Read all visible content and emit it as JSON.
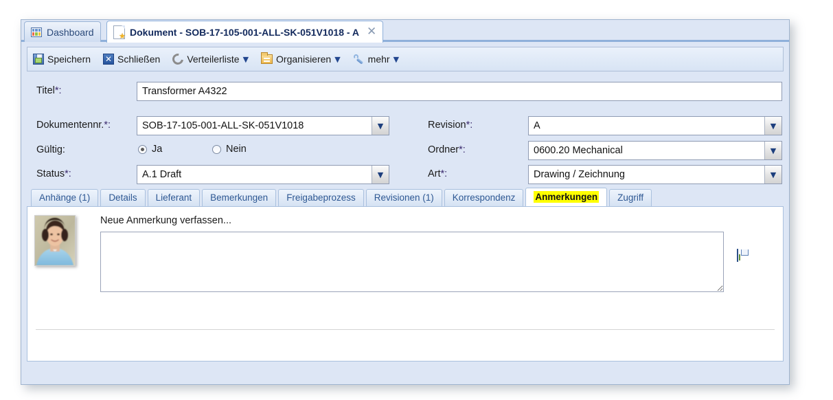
{
  "window_tabs": [
    {
      "label": "Dashboard",
      "icon": "dashboard-grid-icon",
      "active": false,
      "closable": false
    },
    {
      "label": "Dokument - SOB-17-105-001-ALL-SK-051V1018 - A",
      "icon": "document-star-icon",
      "active": true,
      "closable": true,
      "close_glyph": "✕"
    }
  ],
  "toolbar": {
    "items": [
      {
        "label": "Speichern",
        "icon": "save-floppy-icon",
        "caret": false
      },
      {
        "label": "Schließen",
        "icon": "close-x-icon",
        "caret": false
      },
      {
        "label": "Verteilerliste",
        "icon": "distribution-recycle-icon",
        "caret": true
      },
      {
        "label": "Organisieren",
        "icon": "folder-icon",
        "caret": true
      },
      {
        "label": "mehr",
        "icon": "wrench-icon",
        "caret": true
      }
    ],
    "caret_glyph": "▼"
  },
  "form": {
    "title": {
      "label": "Titel",
      "required_mark": "*:",
      "value": "Transformer A4322"
    },
    "document_number": {
      "label": "Dokumentennr.",
      "required_mark": "*:",
      "value": "SOB-17-105-001-ALL-SK-051V1018"
    },
    "valid": {
      "label": "Gültig:",
      "options": [
        {
          "label": "Ja",
          "selected": true
        },
        {
          "label": "Nein",
          "selected": false
        }
      ]
    },
    "status": {
      "label": "Status",
      "required_mark": "*:",
      "value": "A.1 Draft"
    },
    "revision": {
      "label": "Revision",
      "required_mark": "*:",
      "value": "A"
    },
    "folder": {
      "label": "Ordner",
      "required_mark": "*:",
      "value": "0600.20 Mechanical"
    },
    "art": {
      "label": "Art",
      "required_mark": "*:",
      "value": "Drawing / Zeichnung"
    },
    "dropdown_glyph": "▼"
  },
  "content_tabs": [
    {
      "label": "Anhänge (1)",
      "active": false
    },
    {
      "label": "Details",
      "active": false
    },
    {
      "label": "Lieferant",
      "active": false
    },
    {
      "label": "Bemerkungen",
      "active": false
    },
    {
      "label": "Freigabeprozess",
      "active": false
    },
    {
      "label": "Revisionen (1)",
      "active": false
    },
    {
      "label": "Korrespondenz",
      "active": false
    },
    {
      "label": "Anmerkungen",
      "active": true,
      "highlight": true
    },
    {
      "label": "Zugriff",
      "active": false
    }
  ],
  "annotations_panel": {
    "compose_label": "Neue Anmerkung verfassen...",
    "compose_value": "",
    "compose_placeholder": "",
    "avatar": "user-avatar-photo",
    "save_icon": "save-floppy-icon"
  },
  "colors": {
    "window_bg": "#dde6f5",
    "accent_blue": "#2e5893",
    "highlight_yellow": "#ffff00",
    "panel_bg": "#ffffff",
    "border": "#a9c0de"
  }
}
